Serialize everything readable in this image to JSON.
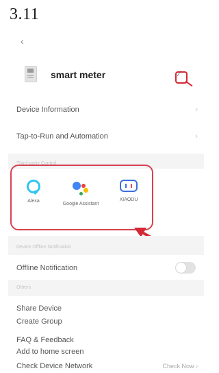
{
  "step_number": "3.11",
  "header": {
    "back_icon": "chevron-left-icon",
    "device_name": "smart meter",
    "edit_icon": "edit-pencil-icon"
  },
  "menu_rows": {
    "device_information": "Device Information",
    "tap_to_run": "Tap-to-Run and Automation",
    "offline_notification": "Offline Notification",
    "share_device": "Share Device",
    "create_group": "Create Group",
    "faq_feedback": "FAQ & Feedback",
    "add_to_home": "Add to home screen",
    "check_network": "Check Device Network",
    "check_now": "Check Now"
  },
  "section_labels": {
    "third_party": "Third-party Control",
    "offline_section": "Device Offline Notification",
    "others": "Others"
  },
  "third_party_services": [
    {
      "label": "Alexa",
      "icon": "alexa-icon"
    },
    {
      "label": "Google Assistant",
      "icon": "google-assistant-icon"
    },
    {
      "label": "XIAODU",
      "icon": "xiaodu-icon"
    }
  ],
  "offline_toggle": {
    "on": false
  },
  "colors": {
    "highlight": "#d6424f",
    "arrow": "#d42a36",
    "band": "#f4f4f4",
    "toggle_off": "#e2e2e2"
  }
}
